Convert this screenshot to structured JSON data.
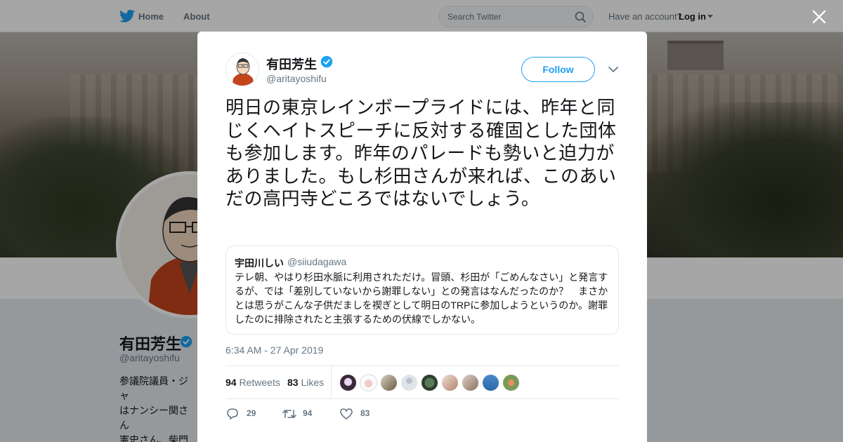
{
  "topnav": {
    "home_label": "Home",
    "about_label": "About",
    "search_placeholder": "Search Twitter",
    "account_prompt": "Have an account?",
    "login_label": "Log in"
  },
  "profile": {
    "name": "有田芳生",
    "handle": "@aritayoshifu",
    "bio_lines": "参議院議員・ジャ\nはナンシー関さん\n憲史さん、柴門ふ\nなど適宜変わりま\nす。「つぶやき」"
  },
  "tweet": {
    "author_name": "有田芳生",
    "author_handle": "@aritayoshifu",
    "follow_label": "Follow",
    "text": "明日の東京レインボープライドには、昨年と同じくヘイトスピーチに反対する確固とした団体も参加します。昨年のパレードも勢いと迫力がありました。もし杉田さんが来れば、このあいだの高円寺どころではないでしょう。",
    "quote": {
      "name": "宇田川しい",
      "handle": "@siiudagawa",
      "text": "テレ朝、やはり杉田水脈に利用されただけ。冒頭、杉田が「ごめんなさい」と発言するが、では「差別していないから謝罪しない」との発言はなんだったのか？　まさかとは思うがこんな子供だましを禊ぎとして明日のTRPに参加しようというのか。謝罪したのに排除されたと主張するための伏線でしかない。"
    },
    "timestamp": "6:34 AM - 27 Apr 2019",
    "retweets_count": "94",
    "retweets_label": "Retweets",
    "likes_count": "83",
    "likes_label": "Likes",
    "actions": {
      "reply_count": "29",
      "retweet_count": "94",
      "like_count": "83"
    }
  },
  "colors": {
    "accent": "#1da1f2",
    "muted": "#657786",
    "text": "#14171a",
    "border": "#e1e8ed"
  },
  "icons": [
    "twitter-bird-icon",
    "search-icon",
    "caret-down-icon",
    "close-icon",
    "verified-badge-icon",
    "chevron-down-icon",
    "reply-icon",
    "retweet-icon",
    "heart-icon"
  ]
}
